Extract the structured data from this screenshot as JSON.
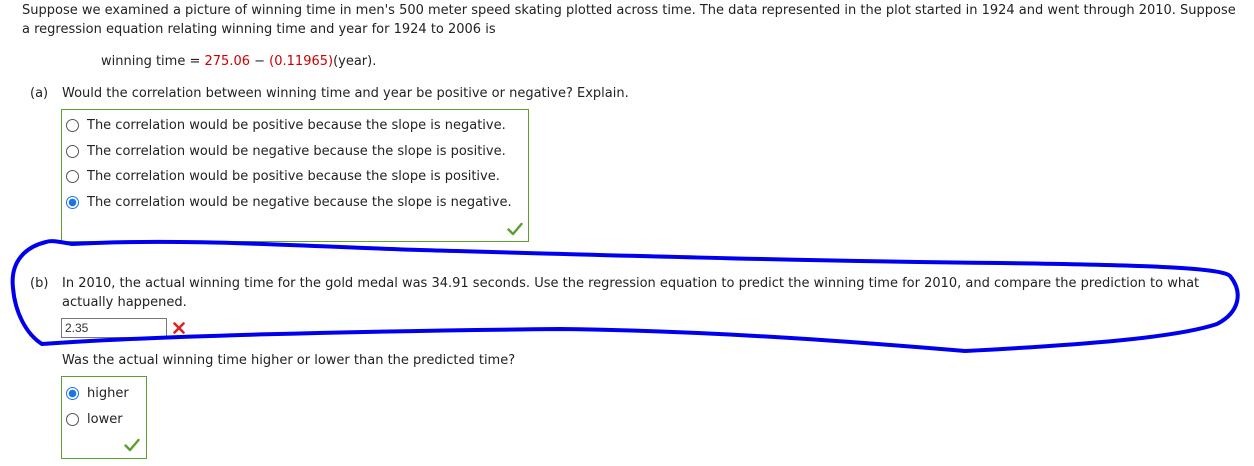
{
  "intro": {
    "line1": "Suppose we examined a picture of winning time in men's 500 meter speed skating plotted across time. The data represented in the plot started in 1924 and went through 2010. Suppose",
    "line2": "a regression equation relating winning time and year for 1924 to 2006 is"
  },
  "equation": {
    "prefix": "winning time = ",
    "intercept": "275.06",
    "minus": " − ",
    "slope": "(0.11965)",
    "suffix": "(year)."
  },
  "part_a": {
    "label": "(a)",
    "question": "Would the correlation between winning time and year be positive or negative? Explain.",
    "options": [
      {
        "label": "The correlation would be positive because the slope is negative.",
        "selected": false
      },
      {
        "label": "The correlation would be negative because the slope is positive.",
        "selected": false
      },
      {
        "label": "The correlation would be positive because the slope is positive.",
        "selected": false
      },
      {
        "label": "The correlation would be negative because the slope is negative.",
        "selected": true
      }
    ],
    "status": "correct"
  },
  "part_b": {
    "label": "(b)",
    "question_line1": "In 2010, the actual winning time for the gold medal was 34.91 seconds. Use the regression equation to predict the winning time for 2010, and compare the prediction to what",
    "question_line2": "actually happened.",
    "input_value": "2.35",
    "input_status": "incorrect",
    "followup": "Was the actual winning time higher or lower than the predicted time?",
    "options": [
      {
        "label": "higher",
        "selected": true
      },
      {
        "label": "lower",
        "selected": false
      }
    ],
    "status": "correct"
  },
  "colors": {
    "correct": "#5aa02c",
    "incorrect": "#dd2222",
    "annotation": "#0000ee",
    "accent": "#1a73e8"
  }
}
